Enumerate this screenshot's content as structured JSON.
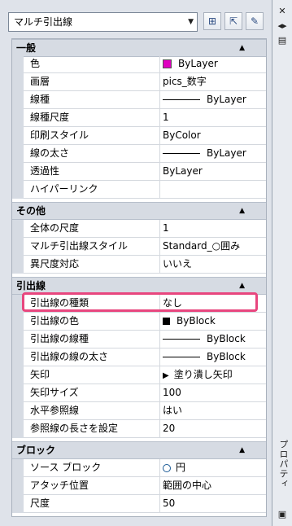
{
  "toolbar": {
    "selector_value": "マルチ引出線",
    "btn1_icon": "quick-select-icon",
    "btn2_icon": "select-objects-icon",
    "btn3_icon": "toggle-pickadd-icon"
  },
  "rail": {
    "title": "プロパティ",
    "close_icon": "close-icon",
    "pin_icon": "auto-hide-icon",
    "menu_icon": "properties-menu-icon"
  },
  "categories": {
    "general": "一般",
    "other": "その他",
    "leader": "引出線",
    "block": "ブロック"
  },
  "general": {
    "color_label": "色",
    "color_value": "ByLayer",
    "color_swatch": "#e000c0",
    "layer_label": "画層",
    "layer_value": "pics_数字",
    "linetype_label": "線種",
    "linetype_value": "ByLayer",
    "ltscale_label": "線種尺度",
    "ltscale_value": "1",
    "plotstyle_label": "印刷スタイル",
    "plotstyle_value": "ByColor",
    "lineweight_label": "線の太さ",
    "lineweight_value": "ByLayer",
    "transparency_label": "透過性",
    "transparency_value": "ByLayer",
    "hyperlink_label": "ハイパーリンク",
    "hyperlink_value": ""
  },
  "other": {
    "overall_scale_label": "全体の尺度",
    "overall_scale_value": "1",
    "mleader_style_label": "マルチ引出線スタイル",
    "mleader_style_value": "Standard_○囲み",
    "annotative_label": "異尺度対応",
    "annotative_value": "いいえ"
  },
  "leader": {
    "type_label": "引出線の種類",
    "type_value": "なし",
    "color_label": "引出線の色",
    "color_value": "ByBlock",
    "color_swatch": "#000000",
    "linetype_label": "引出線の線種",
    "linetype_value": "ByBlock",
    "lineweight_label": "引出線の線の太さ",
    "lineweight_value": "ByBlock",
    "arrowhead_label": "矢印",
    "arrowhead_value": "塗り潰し矢印",
    "arrow_size_label": "矢印サイズ",
    "arrow_size_value": "100",
    "horizontal_landing_label": "水平参照線",
    "horizontal_landing_value": "はい",
    "landing_distance_label": "参照線の長さを設定",
    "landing_distance_value": "20"
  },
  "block": {
    "source_label": "ソース ブロック",
    "source_value": "円",
    "attachment_label": "アタッチ位置",
    "attachment_value": "範囲の中心",
    "scale_label": "尺度",
    "scale_value": "50"
  },
  "colors": {
    "highlight": "#e8467e",
    "category_bg": "#d6dbe3"
  }
}
